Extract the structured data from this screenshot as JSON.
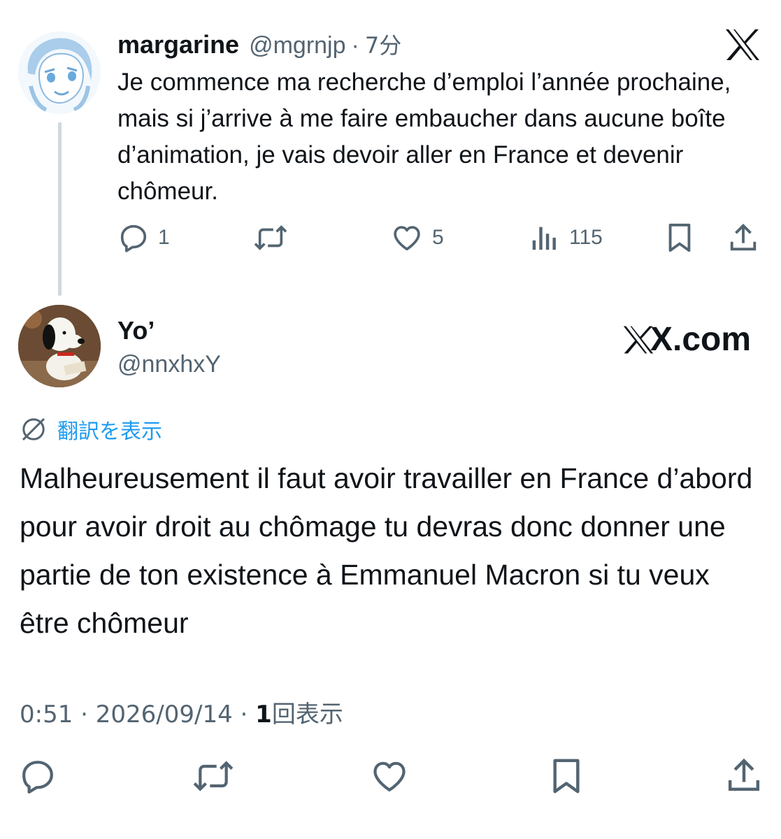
{
  "icons": {
    "x_logo": "x-logo-icon",
    "reply": "reply-icon",
    "repost": "repost-icon",
    "like": "heart-icon",
    "views": "analytics-icon",
    "bookmark": "bookmark-icon",
    "share": "share-icon",
    "translate": "translate-globe-icon"
  },
  "colors": {
    "link": "#1d9bf0",
    "muted": "#536471",
    "text": "#0f1419",
    "thread_line": "#cfd9de"
  },
  "parent_tweet": {
    "display_name": "margarine",
    "handle": "@mgrnjp",
    "separator": "·",
    "time": "7分",
    "text": "Je commence ma recherche d’emploi l’année prochaine, mais si j’arrive à me faire embaucher dans aucune boîte d’animation, je vais devoir aller en France et devenir chômeur.",
    "replies": "1",
    "likes": "5",
    "views": "115"
  },
  "reply_tweet": {
    "display_name": "Yo’",
    "handle": "@nnxhxY",
    "watermark": "X.com",
    "translate_label": "翻訳を表示",
    "text": "Malheureusement il faut avoir travailler en France d’abord pour avoir droit au chômage tu devras donc donner une partie de ton existence à Emmanuel Macron si tu veux être chômeur",
    "timestamp": "0:51 · 2026/09/14 · ",
    "views_count": "1",
    "views_label": "回表示"
  }
}
